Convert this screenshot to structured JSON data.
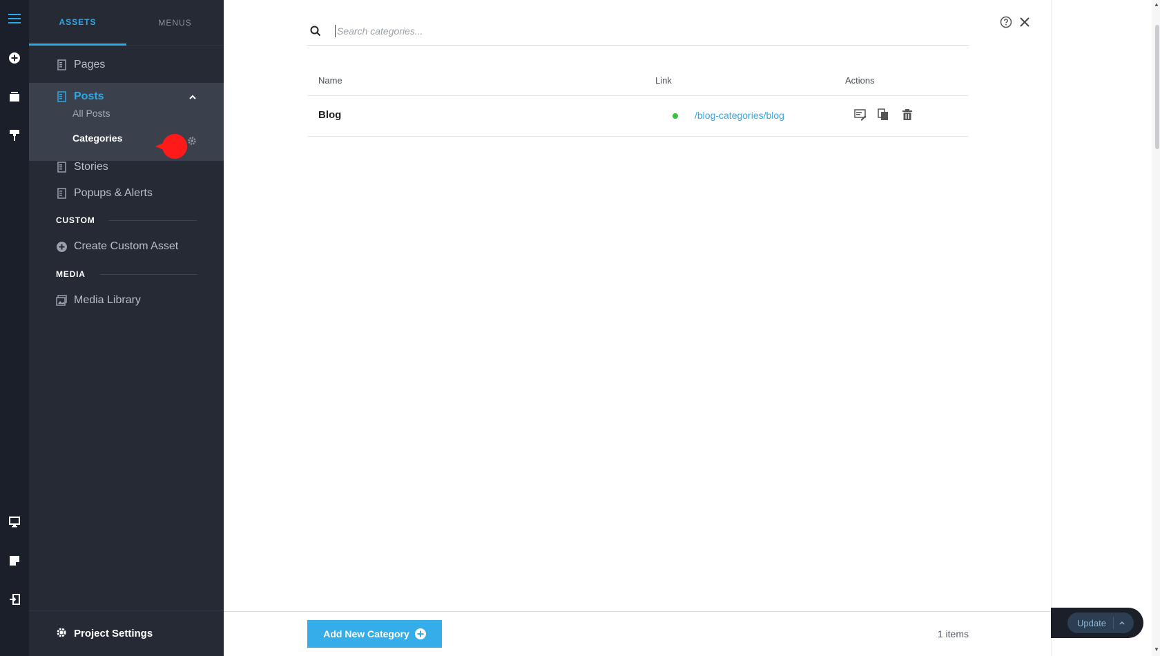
{
  "sidebar": {
    "tabs": [
      {
        "label": "ASSETS",
        "active": true
      },
      {
        "label": "MENUS",
        "active": false
      }
    ],
    "items": {
      "pages": "Pages",
      "posts": "Posts",
      "all_posts": "All Posts",
      "categories": "Categories",
      "stories": "Stories",
      "popups": "Popups & Alerts",
      "create_custom": "Create Custom Asset",
      "media_library": "Media Library"
    },
    "sections": {
      "custom": "CUSTOM",
      "media": "MEDIA"
    },
    "footer": "Project Settings"
  },
  "search": {
    "placeholder": "Search categories..."
  },
  "table": {
    "headers": {
      "name": "Name",
      "link": "Link",
      "actions": "Actions"
    },
    "rows": [
      {
        "name": "Blog",
        "link": "/blog-categories/blog",
        "status": "published"
      }
    ]
  },
  "footer": {
    "add_button": "Add New Category",
    "count": "1 items"
  },
  "publish": {
    "update_label": "Update"
  },
  "colors": {
    "accent": "#2ea9e6",
    "status_live": "#36c13f",
    "rail": "#1a1f29",
    "sidebar": "#252a35"
  }
}
